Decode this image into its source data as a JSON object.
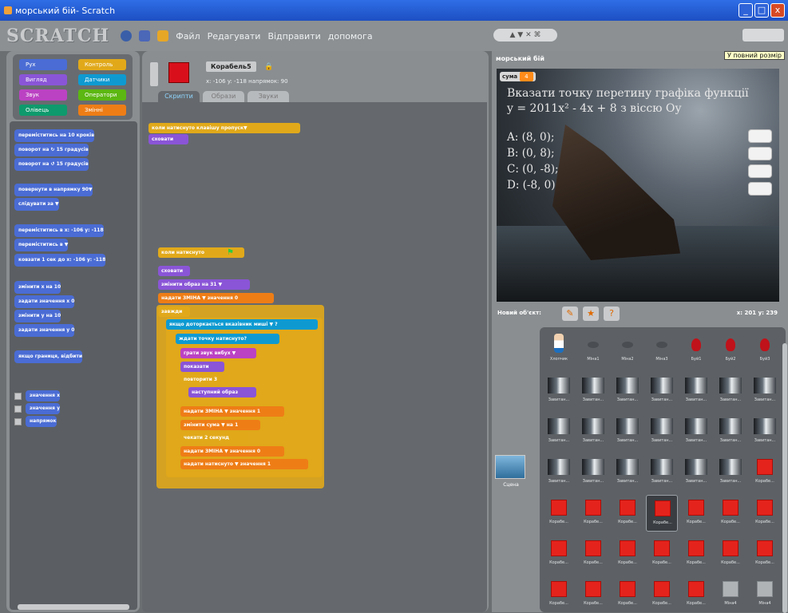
{
  "window": {
    "title": "морський бій- Scratch",
    "min": "_",
    "max": "□",
    "close": "x"
  },
  "menubar": {
    "logo": "SCRATCH",
    "items": [
      "Файл",
      "Редагувати",
      "Відправити",
      "допомога"
    ],
    "modes": "▲ ▼ ✕ ⌘"
  },
  "palette": {
    "categories": [
      {
        "label": "Рух",
        "color": "#4a6cd4"
      },
      {
        "label": "Контроль",
        "color": "#e1a91a"
      },
      {
        "label": "Вигляд",
        "color": "#8a55d7"
      },
      {
        "label": "Датчики",
        "color": "#0e9ad1"
      },
      {
        "label": "Звук",
        "color": "#bb42c3"
      },
      {
        "label": "Оператори",
        "color": "#5cb712"
      },
      {
        "label": "Олівець",
        "color": "#0e9a6c"
      },
      {
        "label": "Змінні",
        "color": "#ee7d16"
      }
    ],
    "blocks": [
      "переміститись на 10 кроків",
      "поворот на ↻ 15 градусів",
      "поворот на ↺ 15 градусів",
      "повернути в напрямку 90▼",
      "слідувати за ▼",
      "переміститись в x: -106 y: -118",
      "переміститись в ▼",
      "ковзати 1 сек до x: -106 y: -118",
      "змінити x на 10",
      "задати значення x 0",
      "змінити y на 10",
      "задати значення y 0",
      "якщо границя, відбити"
    ],
    "checkboxes": [
      "значення x",
      "значення y",
      "напрямок"
    ]
  },
  "sprite": {
    "name": "Корабель5",
    "coords": "x: -106 y: -118 напрямок: 90"
  },
  "tabs": [
    "Скрипти",
    "Образи",
    "Звуки"
  ],
  "scripts": {
    "hat1": "коли натиснуто клавішу пропуск▼",
    "hat1_next": "сховати",
    "hat2": "коли натиснуто",
    "lines": [
      "сховати",
      "змінити образ на 31 ▼",
      "надати ЗМІНА ▼ значення 0",
      "завжди",
      "якщо доторкається вказівник миші ▼ ?",
      "ждати точку натиснуто?",
      "грати звук вибух ▼",
      "показати",
      "повторити 3",
      "наступний образ",
      "надати ЗМІНА ▼ значення 1",
      "змінити сума ▼ на 1",
      "чекати 2 секунд",
      "надати ЗМІНА ▼ значення 0",
      "надати натиснуто ▼ значення 1"
    ]
  },
  "stage": {
    "title": "морський бій",
    "tooltip": "У повний розмір",
    "watcher_label": "сума",
    "watcher_value": "4",
    "question": "Вказати точку перетину графіка функції\ny = 2011x² - 4x + 8 з віссю Оу",
    "options": [
      "A: (8, 0);",
      "B: (0, 8);",
      "C: (0, -8);",
      "D: (-8, 0)"
    ]
  },
  "sprites_panel": {
    "new_label": "Новий об'єкт:",
    "mouse": "x: 201   y: 239",
    "stage_label": "Сцена",
    "sprites": [
      {
        "name": "Хлопчик",
        "kind": "boy"
      },
      {
        "name": "Міна1",
        "kind": "mine"
      },
      {
        "name": "Міна2",
        "kind": "mine"
      },
      {
        "name": "Міна3",
        "kind": "mine"
      },
      {
        "name": "Буй1",
        "kind": "buoy"
      },
      {
        "name": "Буй2",
        "kind": "buoy"
      },
      {
        "name": "Буй3",
        "kind": "buoy"
      },
      {
        "name": "Завитан...",
        "kind": "shot"
      },
      {
        "name": "Завитан...",
        "kind": "shot"
      },
      {
        "name": "Завитан...",
        "kind": "shot"
      },
      {
        "name": "Завитан...",
        "kind": "shot"
      },
      {
        "name": "Завитан...",
        "kind": "shot"
      },
      {
        "name": "Завитан...",
        "kind": "shot"
      },
      {
        "name": "Завитан...",
        "kind": "shot"
      },
      {
        "name": "Завитан...",
        "kind": "shot"
      },
      {
        "name": "Завитан...",
        "kind": "shot"
      },
      {
        "name": "Завитан...",
        "kind": "shot"
      },
      {
        "name": "Завитан...",
        "kind": "shot"
      },
      {
        "name": "Завитан...",
        "kind": "shot"
      },
      {
        "name": "Завитан...",
        "kind": "shot"
      },
      {
        "name": "Завитан...",
        "kind": "shot"
      },
      {
        "name": "Завитан...",
        "kind": "shot"
      },
      {
        "name": "Завитан...",
        "kind": "shot"
      },
      {
        "name": "Завитан...",
        "kind": "shot"
      },
      {
        "name": "Завитан...",
        "kind": "shot"
      },
      {
        "name": "Завитан...",
        "kind": "shot"
      },
      {
        "name": "Завитан...",
        "kind": "shot"
      },
      {
        "name": "Корабе...",
        "kind": "red"
      },
      {
        "name": "Корабе...",
        "kind": "red"
      },
      {
        "name": "Корабе...",
        "kind": "red"
      },
      {
        "name": "Корабе...",
        "kind": "red"
      },
      {
        "name": "Корабе...",
        "kind": "red",
        "selected": true
      },
      {
        "name": "Корабе...",
        "kind": "red"
      },
      {
        "name": "Корабе...",
        "kind": "red"
      },
      {
        "name": "Корабе...",
        "kind": "red"
      },
      {
        "name": "Корабе...",
        "kind": "red"
      },
      {
        "name": "Корабе...",
        "kind": "red"
      },
      {
        "name": "Корабе...",
        "kind": "red"
      },
      {
        "name": "Корабе...",
        "kind": "red"
      },
      {
        "name": "Корабе...",
        "kind": "red"
      },
      {
        "name": "Корабе...",
        "kind": "red"
      },
      {
        "name": "Корабе...",
        "kind": "red"
      },
      {
        "name": "Корабе...",
        "kind": "red"
      },
      {
        "name": "Корабе...",
        "kind": "red"
      },
      {
        "name": "Корабе...",
        "kind": "red"
      },
      {
        "name": "Корабе...",
        "kind": "red"
      },
      {
        "name": "Корабе...",
        "kind": "red"
      },
      {
        "name": "Міна4",
        "kind": "gray"
      },
      {
        "name": "Міна4",
        "kind": "gray"
      }
    ]
  }
}
